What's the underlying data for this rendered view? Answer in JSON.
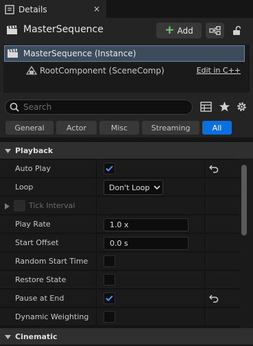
{
  "tab": {
    "label": "Details",
    "close": "×"
  },
  "header": {
    "title": "MasterSequence",
    "add_label": "Add",
    "add_plus": "+"
  },
  "tree": {
    "selected_label": "MasterSequence (Instance)",
    "child_label": "RootComponent (SceneComp)",
    "edit_link": "Edit in C++"
  },
  "search": {
    "placeholder": "Search"
  },
  "filters": [
    "General",
    "Actor",
    "Misc",
    "Streaming",
    "All"
  ],
  "active_filter": "All",
  "categories": {
    "playback": "Playback",
    "cinematic": "Cinematic"
  },
  "properties": {
    "auto_play": {
      "label": "Auto Play",
      "checked": true
    },
    "loop": {
      "label": "Loop",
      "value": "Don't Loop"
    },
    "tick_interval": {
      "label": "Tick Interval"
    },
    "play_rate": {
      "label": "Play Rate",
      "value": "1.0 x"
    },
    "start_offset": {
      "label": "Start Offset",
      "value": "0.0 s"
    },
    "random_start_time": {
      "label": "Random Start Time",
      "checked": false
    },
    "restore_state": {
      "label": "Restore State",
      "checked": false
    },
    "pause_at_end": {
      "label": "Pause at End",
      "checked": true
    },
    "dynamic_weighting": {
      "label": "Dynamic Weighting",
      "checked": false
    }
  },
  "colors": {
    "accent": "#0a70e0",
    "check": "#3d9bff",
    "add_plus": "#6fd06f"
  }
}
